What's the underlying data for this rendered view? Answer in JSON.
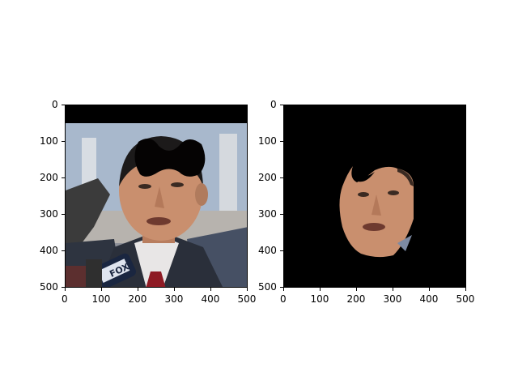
{
  "chart_data": [
    {
      "type": "image",
      "name": "original-photo",
      "content": "photo of a man in suit with red tie speaking into microphones; black band at top; dark occlusion mask over forehead",
      "xlim": [
        0,
        500
      ],
      "ylim": [
        500,
        0
      ],
      "xticks": [
        "0",
        "100",
        "200",
        "300",
        "400",
        "500"
      ],
      "yticks": [
        "0",
        "100",
        "200",
        "300",
        "400",
        "500"
      ],
      "mic_label": "FOX",
      "colors": {
        "background_top": "#000000",
        "sky": "#a8b8cc",
        "skin": "#c98f6e",
        "hair": "#1c1a1a",
        "suit": "#2a2f3a",
        "tie": "#8e1a24",
        "shirt": "#e8e6e6"
      }
    },
    {
      "type": "image",
      "name": "face-mask-extraction",
      "content": "extracted face region on black background, forehead cut out",
      "xlim": [
        0,
        500
      ],
      "ylim": [
        500,
        0
      ],
      "xticks": [
        "0",
        "100",
        "200",
        "300",
        "400",
        "500"
      ],
      "yticks": [
        "0",
        "100",
        "200",
        "300",
        "400",
        "500"
      ],
      "colors": {
        "background": "#000000",
        "skin": "#c98f6e"
      }
    }
  ]
}
